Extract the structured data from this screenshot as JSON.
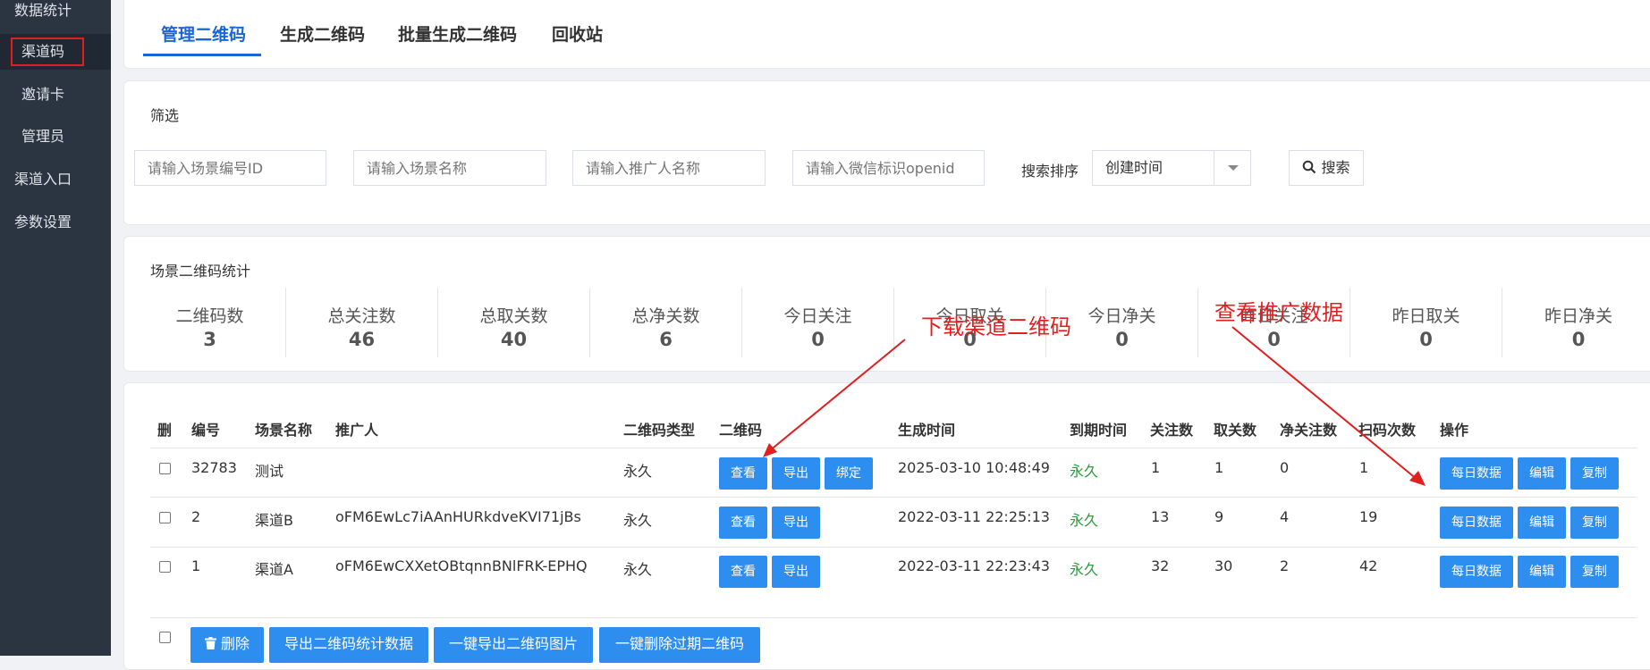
{
  "sidebar": {
    "items": [
      {
        "label": "数据统计"
      },
      {
        "label": "渠道码"
      },
      {
        "label": "邀请卡"
      },
      {
        "label": "管理员"
      },
      {
        "label": "渠道入口"
      },
      {
        "label": "参数设置"
      }
    ]
  },
  "tabs": [
    "管理二维码",
    "生成二维码",
    "批量生成二维码",
    "回收站"
  ],
  "filter": {
    "title": "筛选",
    "scene_id_placeholder": "请输入场景编号ID",
    "scene_name_placeholder": "请输入场景名称",
    "promoter_placeholder": "请输入推广人名称",
    "openid_placeholder": "请输入微信标识openid",
    "sort_label": "搜索排序",
    "sort_value": "创建时间",
    "search_button": "搜索"
  },
  "stats": {
    "title": "场景二维码统计",
    "items": [
      {
        "label": "二维码数",
        "value": "3"
      },
      {
        "label": "总关注数",
        "value": "46"
      },
      {
        "label": "总取关数",
        "value": "40"
      },
      {
        "label": "总净关数",
        "value": "6"
      },
      {
        "label": "今日关注",
        "value": "0"
      },
      {
        "label": "今日取关",
        "value": "0"
      },
      {
        "label": "今日净关",
        "value": "0"
      },
      {
        "label": "昨日关注",
        "value": "0"
      },
      {
        "label": "昨日取关",
        "value": "0"
      },
      {
        "label": "昨日净关",
        "value": "0"
      }
    ]
  },
  "table": {
    "headers": [
      "删",
      "编号",
      "场景名称",
      "推广人",
      "二维码类型",
      "二维码",
      "生成时间",
      "到期时间",
      "关注数",
      "取关数",
      "净关注数",
      "扫码次数",
      "操作"
    ],
    "rows": [
      {
        "id": "32783",
        "name": "测试",
        "promoter": "",
        "type": "永久",
        "created": "2025-03-10 10:48:49",
        "expire": "永久",
        "follow": "1",
        "unfollow": "1",
        "net": "0",
        "scans": "1",
        "has_bind": true
      },
      {
        "id": "2",
        "name": "渠道B",
        "promoter": "oFM6EwLc7iAAnHURkdveKVI71jBs",
        "type": "永久",
        "created": "2022-03-11 22:25:13",
        "expire": "永久",
        "follow": "13",
        "unfollow": "9",
        "net": "4",
        "scans": "19",
        "has_bind": false
      },
      {
        "id": "1",
        "name": "渠道A",
        "promoter": "oFM6EwCXXetOBtqnnBNlFRK-EPHQ",
        "type": "永久",
        "created": "2022-03-11 22:23:43",
        "expire": "永久",
        "follow": "32",
        "unfollow": "30",
        "net": "2",
        "scans": "42",
        "has_bind": false
      }
    ],
    "qr_buttons": {
      "view": "查看",
      "export": "导出",
      "bind": "绑定"
    },
    "op_buttons": {
      "daily": "每日数据",
      "edit": "编辑",
      "copy": "复制"
    }
  },
  "footer_buttons": {
    "delete": "删除",
    "export_stats": "导出二维码统计数据",
    "export_images": "一键导出二维码图片",
    "delete_expired": "一键删除过期二维码"
  },
  "annotations": {
    "download": "下载渠道二维码",
    "promo": "查看推广数据"
  },
  "colors": {
    "sidebar": "#2b3542",
    "accent": "#1a66d6",
    "button": "#2e8ef0",
    "annotation": "#e02020",
    "permanent": "#2a9d3a"
  }
}
